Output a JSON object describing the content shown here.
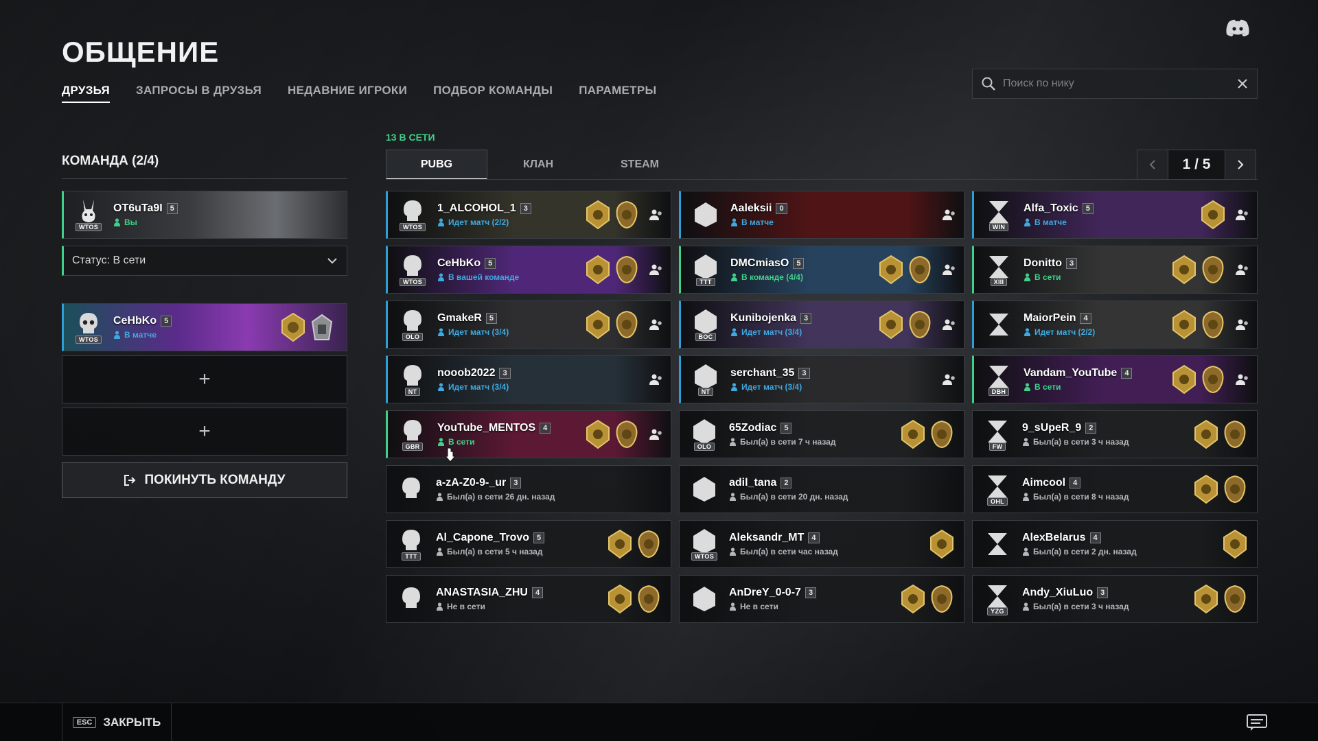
{
  "page": {
    "title": "ОБЩЕНИЕ"
  },
  "nav": [
    {
      "label": "ДРУЗЬЯ",
      "active": true
    },
    {
      "label": "ЗАПРОСЫ В ДРУЗЬЯ",
      "active": false
    },
    {
      "label": "НЕДАВНИЕ ИГРОКИ",
      "active": false
    },
    {
      "label": "ПОДБОР КОМАНДЫ",
      "active": false
    },
    {
      "label": "ПАРАМЕТРЫ",
      "active": false
    }
  ],
  "search": {
    "placeholder": "Поиск по нику",
    "value": ""
  },
  "team": {
    "header": "КОМАНДА (2/4)",
    "me": {
      "name": "OT6uTa9I",
      "level": "5",
      "status": "Вы",
      "clan": "WTOS",
      "icon": "rabbit-emblem"
    },
    "status_select": "Статус: В сети",
    "member": {
      "name": "CeHbKo",
      "level": "5",
      "status": "В матче",
      "clan": "WTOS",
      "icon": "skull-emblem"
    },
    "add_slot_symbol": "+",
    "leave_label": "ПОКИНУТЬ КОМАНДУ"
  },
  "friends": {
    "online_count": "13 В СЕТИ",
    "tabs": [
      {
        "label": "PUBG",
        "active": true
      },
      {
        "label": "КЛАН",
        "active": false
      },
      {
        "label": "STEAM",
        "active": false
      }
    ],
    "pager": {
      "label": "1 / 5"
    },
    "list": [
      {
        "name": "1_ALCOHOL_1",
        "level": "3",
        "status": "Идет матч (2/2)",
        "state": "busy",
        "clan": "WTOS",
        "badges": 2,
        "invite": true,
        "bg": "#3a3a2e"
      },
      {
        "name": "Aaleksii",
        "level": "0",
        "status": "В матче",
        "state": "busy",
        "clan": "",
        "badges": 0,
        "invite": true,
        "bg": "#5a1416"
      },
      {
        "name": "Alfa_Toxic",
        "level": "5",
        "status": "В матче",
        "state": "busy",
        "clan": "WIN",
        "badges": 1,
        "invite": true,
        "bg": "#4a2a66"
      },
      {
        "name": "CeHbKo",
        "level": "5",
        "status": "В вашей команде",
        "state": "busy",
        "clan": "WTOS",
        "badges": 2,
        "invite": true,
        "bg": "#5b2b8a"
      },
      {
        "name": "DMCmiasO",
        "level": "5",
        "status": "В команде (4/4)",
        "state": "online",
        "clan": "TTT",
        "badges": 2,
        "invite": true,
        "bg": "#2a4a6a"
      },
      {
        "name": "Donitto",
        "level": "3",
        "status": "В сети",
        "state": "online",
        "clan": "XIII",
        "badges": 2,
        "invite": true,
        "bg": "#3a3a3a"
      },
      {
        "name": "GmakeR",
        "level": "5",
        "status": "Идет матч (3/4)",
        "state": "busy",
        "clan": "OLO",
        "badges": 2,
        "invite": true,
        "bg": "#333336"
      },
      {
        "name": "Kunibojenka",
        "level": "3",
        "status": "Идет матч (3/4)",
        "state": "busy",
        "clan": "BOC",
        "badges": 2,
        "invite": true,
        "bg": "#4a3a66"
      },
      {
        "name": "MaiorPein",
        "level": "4",
        "status": "Идет матч (2/2)",
        "state": "busy",
        "clan": "",
        "badges": 2,
        "invite": true,
        "bg": "#3a3a3a"
      },
      {
        "name": "nooob2022",
        "level": "3",
        "status": "Идет матч (3/4)",
        "state": "busy",
        "clan": "NT",
        "badges": 0,
        "invite": true,
        "bg": "#2a3640"
      },
      {
        "name": "serchant_35",
        "level": "3",
        "status": "Идет матч (3/4)",
        "state": "busy",
        "clan": "NT",
        "badges": 0,
        "invite": true,
        "bg": "#2e2e30"
      },
      {
        "name": "Vandam_YouTube",
        "level": "4",
        "status": "В сети",
        "state": "online",
        "clan": "DBH",
        "badges": 2,
        "invite": true,
        "bg": "#4a2060"
      },
      {
        "name": "YouTube_MENTOS",
        "level": "4",
        "status": "В сети",
        "state": "online",
        "clan": "GBR",
        "badges": 2,
        "invite": true,
        "bg": "#6a1a3a"
      },
      {
        "name": "65Zodiac",
        "level": "5",
        "status": "Был(а) в сети 7 ч назад",
        "state": "offline",
        "clan": "OLO",
        "badges": 2,
        "invite": false,
        "bg": "#202224"
      },
      {
        "name": "9_sUpeR_9",
        "level": "2",
        "status": "Был(а) в сети 3 ч назад",
        "state": "offline",
        "clan": "FW",
        "badges": 2,
        "invite": false,
        "bg": "#202224"
      },
      {
        "name": "a-zA-Z0-9-_ur",
        "level": "3",
        "status": "Был(а) в сети 26 дн. назад",
        "state": "offline",
        "clan": "",
        "badges": 0,
        "invite": false,
        "bg": "#1c1d1f"
      },
      {
        "name": "adil_tana",
        "level": "2",
        "status": "Был(а) в сети 20 дн. назад",
        "state": "offline",
        "clan": "",
        "badges": 0,
        "invite": false,
        "bg": "#1c1d1f"
      },
      {
        "name": "Aimcool",
        "level": "4",
        "status": "Был(а) в сети 8 ч назад",
        "state": "offline",
        "clan": "OHL",
        "badges": 2,
        "invite": false,
        "bg": "#1c1d1f"
      },
      {
        "name": "Al_Capone_Trovo",
        "level": "5",
        "status": "Был(а) в сети 5 ч назад",
        "state": "offline",
        "clan": "TTT",
        "badges": 2,
        "invite": false,
        "bg": "#1c1d1f"
      },
      {
        "name": "Aleksandr_MT",
        "level": "4",
        "status": "Был(а) в сети час назад",
        "state": "offline",
        "clan": "WTOS",
        "badges": 1,
        "invite": false,
        "bg": "#1c1d1f"
      },
      {
        "name": "AlexBelarus",
        "level": "4",
        "status": "Был(а) в сети 2 дн. назад",
        "state": "offline",
        "clan": "",
        "badges": 1,
        "invite": false,
        "bg": "#1c1d1f"
      },
      {
        "name": "ANASTASIA_ZHU",
        "level": "4",
        "status": "Не в сети",
        "state": "offline",
        "clan": "",
        "badges": 2,
        "invite": false,
        "bg": "#1c1d1f"
      },
      {
        "name": "AnDreY_0-0-7",
        "level": "3",
        "status": "Не в сети",
        "state": "offline",
        "clan": "",
        "badges": 2,
        "invite": false,
        "bg": "#1c1d1f"
      },
      {
        "name": "Andy_XiuLuo",
        "level": "3",
        "status": "Был(а) в сети 3 ч назад",
        "state": "offline",
        "clan": "YZG",
        "badges": 2,
        "invite": false,
        "bg": "#1c1d1f"
      }
    ]
  },
  "footer": {
    "esc_key": "ESC",
    "close_label": "ЗАКРЫТЬ"
  },
  "colors": {
    "online": "#3fd18a",
    "busy": "#3fa9e0",
    "offline": "#b5b7ba"
  },
  "icons": {
    "discord": "discord-icon",
    "search": "search-icon",
    "clear": "close-icon",
    "chat": "chat-icon",
    "leave": "exit-icon"
  }
}
